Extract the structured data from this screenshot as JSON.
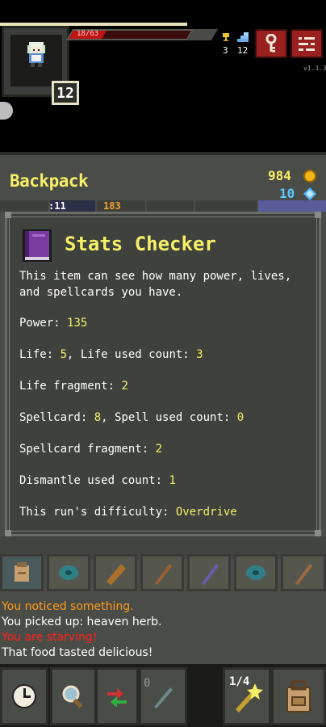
{
  "hud": {
    "hp_text": "18/63",
    "hp_fraction": 0.28,
    "level": "12",
    "stat1": "3",
    "stat2": "12",
    "version": "v1.1.3",
    "icons": {
      "key": "key-icon",
      "menu": "menu-icon"
    }
  },
  "backpack": {
    "title": "Backpack",
    "gold": "984",
    "gems": "10",
    "tab_partial_1": ":11",
    "tab_partial_2": "183"
  },
  "info": {
    "title": "Stats Checker",
    "description": "This item can see how many power, lives, and spellcards you have.",
    "lines": [
      {
        "label": "Power: ",
        "value": "135"
      },
      {
        "label": "Life: ",
        "value": "5",
        "mid": ", Life used count: ",
        "value2": "3"
      },
      {
        "label": "Life fragment: ",
        "value": "2"
      },
      {
        "label": "Spellcard: ",
        "value": "8",
        "mid": ", Spell used count: ",
        "value2": "0"
      },
      {
        "label": "Spellcard fragment: ",
        "value": "2"
      },
      {
        "label": "Dismantle used count: ",
        "value": "1"
      },
      {
        "label": "This run's difficulty: ",
        "value": "Overdrive"
      }
    ]
  },
  "log": [
    {
      "text": "You noticed something.",
      "color": "orange"
    },
    {
      "text": "You picked up: heaven herb.",
      "color": "white"
    },
    {
      "text": "You are starving!",
      "color": "red"
    },
    {
      "text": "That food tasted delicious!",
      "color": "white"
    }
  ],
  "toolbar": {
    "quickslot_count": "1/4",
    "quickslot_zero": "0",
    "buttons": [
      "clock-icon",
      "search-icon",
      "swap-icon",
      "wand-icon",
      "bag-icon"
    ]
  },
  "colors": {
    "accent_yellow": "#f6ef68",
    "panel": "#4a4c47",
    "danger": "#c01414"
  }
}
